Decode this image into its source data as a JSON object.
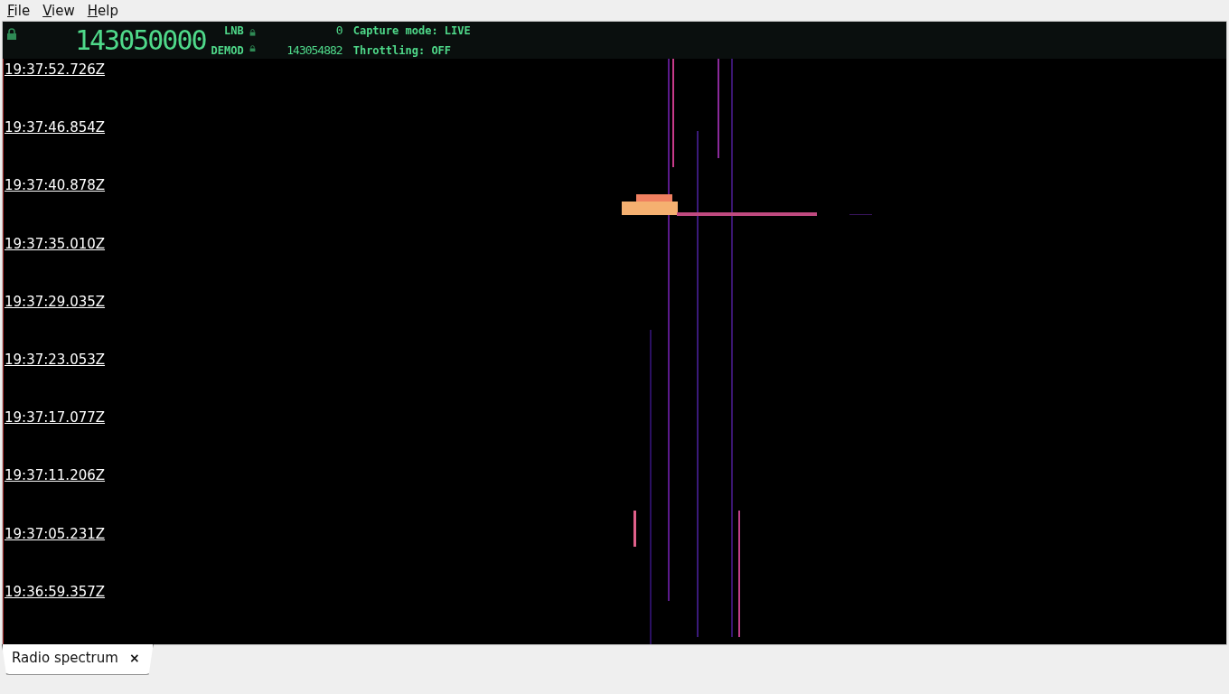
{
  "menu": [
    {
      "label": "File"
    },
    {
      "label": "View"
    },
    {
      "label": "Help"
    }
  ],
  "header": {
    "locked": true,
    "frequency": "143050000",
    "lnb_label": "LNB",
    "lnb_value": "0",
    "demod_label": "DEMOD",
    "demod_value": "143054882",
    "capture_mode": "Capture mode: LIVE",
    "throttling": "Throttling: OFF"
  },
  "timestamps": [
    "19:37:52.726Z",
    "19:37:46.854Z",
    "19:37:40.878Z",
    "19:37:35.010Z",
    "19:37:29.035Z",
    "19:37:23.053Z",
    "19:37:17.077Z",
    "19:37:11.206Z",
    "19:37:05.231Z",
    "19:36:59.357Z"
  ],
  "tabs": [
    {
      "label": "Radio spectrum",
      "close": "×",
      "selected": true
    }
  ]
}
